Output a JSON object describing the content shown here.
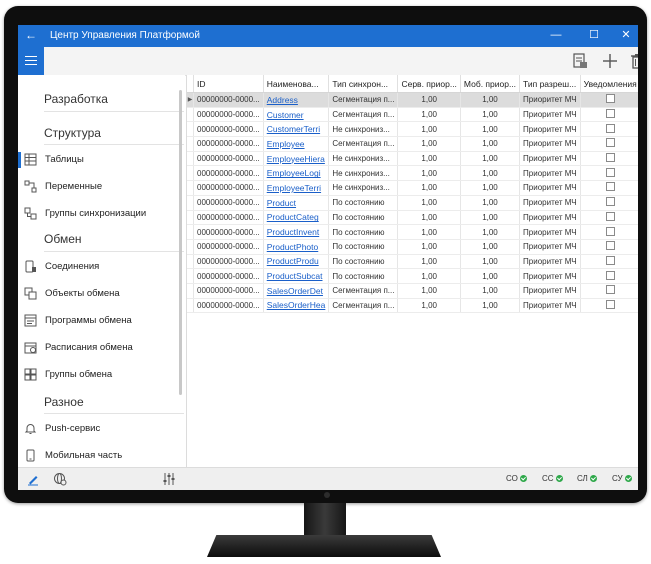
{
  "window": {
    "title": "Центр Управления Платформой",
    "back_glyph": "←",
    "minimize_glyph": "—",
    "maximize_glyph": "☐",
    "close_glyph": "✕"
  },
  "sidebar": {
    "sections": [
      {
        "title": "Разработка",
        "items": []
      },
      {
        "title": "Структура",
        "items": [
          {
            "label": "Таблицы",
            "icon": "table-icon",
            "active": true
          },
          {
            "label": "Переменные",
            "icon": "variables-icon"
          },
          {
            "label": "Группы синхронизации",
            "icon": "sync-groups-icon"
          }
        ]
      },
      {
        "title": "Обмен",
        "items": [
          {
            "label": "Соединения",
            "icon": "connection-icon"
          },
          {
            "label": "Объекты обмена",
            "icon": "exchange-objects-icon"
          },
          {
            "label": "Программы обмена",
            "icon": "exchange-programs-icon"
          },
          {
            "label": "Расписания обмена",
            "icon": "exchange-schedule-icon"
          },
          {
            "label": "Группы обмена",
            "icon": "exchange-groups-icon"
          }
        ]
      },
      {
        "title": "Разное",
        "items": [
          {
            "label": "Push-сервис",
            "icon": "bell-icon"
          },
          {
            "label": "Мобильная часть",
            "icon": "mobile-icon"
          }
        ]
      }
    ]
  },
  "grid": {
    "columns": [
      "ID",
      "Наименова...",
      "Тип синхрон...",
      "Серв. приор...",
      "Моб. приор...",
      "Тип разреш...",
      "Уведомления"
    ],
    "rows": [
      {
        "id": "00000000-0000...",
        "name": "Address",
        "sync": "Сегментация п...",
        "srv": "1,00",
        "mob": "1,00",
        "res": "Приоритет МЧ",
        "selected": true
      },
      {
        "id": "00000000-0000...",
        "name": "Customer",
        "sync": "Сегментация п...",
        "srv": "1,00",
        "mob": "1,00",
        "res": "Приоритет МЧ"
      },
      {
        "id": "00000000-0000...",
        "name": "CustomerTerri",
        "sync": "Не синхрониз...",
        "srv": "1,00",
        "mob": "1,00",
        "res": "Приоритет МЧ"
      },
      {
        "id": "00000000-0000...",
        "name": "Employee",
        "sync": "Сегментация п...",
        "srv": "1,00",
        "mob": "1,00",
        "res": "Приоритет МЧ"
      },
      {
        "id": "00000000-0000...",
        "name": "EmployeeHiera",
        "sync": "Не синхрониз...",
        "srv": "1,00",
        "mob": "1,00",
        "res": "Приоритет МЧ"
      },
      {
        "id": "00000000-0000...",
        "name": "EmployeeLogi",
        "sync": "Не синхрониз...",
        "srv": "1,00",
        "mob": "1,00",
        "res": "Приоритет МЧ"
      },
      {
        "id": "00000000-0000...",
        "name": "EmployeeTerri",
        "sync": "Не синхрониз...",
        "srv": "1,00",
        "mob": "1,00",
        "res": "Приоритет МЧ"
      },
      {
        "id": "00000000-0000...",
        "name": "Product",
        "sync": "По состоянию",
        "srv": "1,00",
        "mob": "1,00",
        "res": "Приоритет МЧ"
      },
      {
        "id": "00000000-0000...",
        "name": "ProductCateg",
        "sync": "По состоянию",
        "srv": "1,00",
        "mob": "1,00",
        "res": "Приоритет МЧ"
      },
      {
        "id": "00000000-0000...",
        "name": "ProductInvent",
        "sync": "По состоянию",
        "srv": "1,00",
        "mob": "1,00",
        "res": "Приоритет МЧ"
      },
      {
        "id": "00000000-0000...",
        "name": "ProductPhoto",
        "sync": "По состоянию",
        "srv": "1,00",
        "mob": "1,00",
        "res": "Приоритет МЧ"
      },
      {
        "id": "00000000-0000...",
        "name": "ProductProdu",
        "sync": "По состоянию",
        "srv": "1,00",
        "mob": "1,00",
        "res": "Приоритет МЧ"
      },
      {
        "id": "00000000-0000...",
        "name": "ProductSubcat",
        "sync": "По состоянию",
        "srv": "1,00",
        "mob": "1,00",
        "res": "Приоритет МЧ"
      },
      {
        "id": "00000000-0000...",
        "name": "SalesOrderDet",
        "sync": "Сегментация п...",
        "srv": "1,00",
        "mob": "1,00",
        "res": "Приоритет МЧ"
      },
      {
        "id": "00000000-0000...",
        "name": "SalesOrderHea",
        "sync": "Сегментация п...",
        "srv": "1,00",
        "mob": "1,00",
        "res": "Приоритет МЧ"
      }
    ]
  },
  "statusbar": {
    "indicators": [
      {
        "label": "СО",
        "status": "ok"
      },
      {
        "label": "СС",
        "status": "ok"
      },
      {
        "label": "СЛ",
        "status": "ok"
      },
      {
        "label": "СУ",
        "status": "ok"
      }
    ]
  },
  "colors": {
    "accent": "#1e6fd1",
    "link": "#1a5fc9",
    "ok": "#2ea84a"
  }
}
